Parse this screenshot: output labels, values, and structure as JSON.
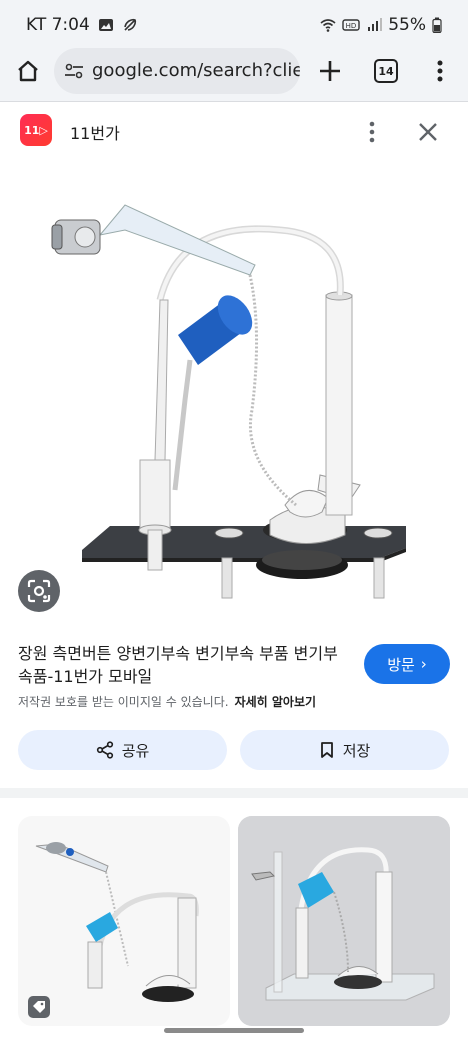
{
  "status_bar": {
    "carrier_time": "KT 7:04",
    "battery": "55%",
    "icons": [
      "image-icon",
      "feather-icon",
      "wifi-icon",
      "hd-icon",
      "signal-icon",
      "battery-icon"
    ]
  },
  "browser": {
    "url": "google.com/search?client",
    "tab_count": "14",
    "icons": [
      "home-icon",
      "tune-icon",
      "plus-icon",
      "tabs-icon",
      "menu-icon"
    ]
  },
  "result": {
    "site_name": "11번가",
    "site_logo_text": "11",
    "title": "장원 측면버튼 양변기부속 변기부속 부품 변기부속품-11번가 모바일",
    "visit_label": "방문",
    "copyright_text": "저작권 보호를 받는 이미지일 수 있습니다.",
    "learn_more": "자세히 알아보기",
    "share_label": "공유",
    "save_label": "저장"
  },
  "colors": {
    "accent": "#1a73e8",
    "chip_bg": "#e8f0fe",
    "brand": "#ff2d55",
    "flush_blue": "#1f5fbf",
    "float_cyan": "#29a8e0"
  }
}
